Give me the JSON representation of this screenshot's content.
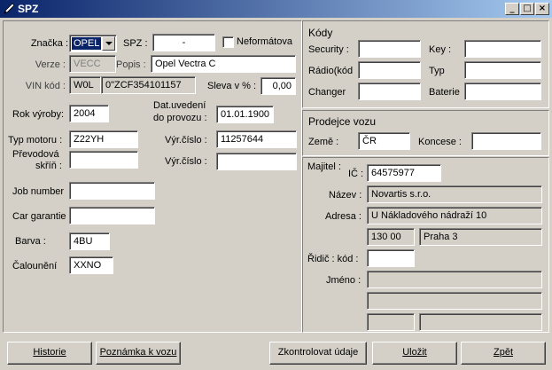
{
  "window": {
    "title": "SPZ",
    "controls": [
      "_",
      "□",
      "×"
    ]
  },
  "vehicle": {
    "znacka_label": "Značka :",
    "znacka_value": "OPEL",
    "spz_label": "SPZ :",
    "spz_value": "-",
    "neformatova_label": "Neformátova",
    "verze_label": "Verze :",
    "verze_value": "VECC",
    "popis_label": "Popis :",
    "popis_value": "Opel Vectra C",
    "vin_label": "VIN kód :",
    "vin_prefix": "W0L",
    "vin_value": "0\"ZCF354101157",
    "sleva_label": "Sleva v % :",
    "sleva_value": "0,00",
    "rok_label": "Rok výroby:",
    "rok_value": "2004",
    "dat_label_1": "Dat.uvedení",
    "dat_label_2": "do provozu :",
    "dat_value": "01.01.1900",
    "typ_motoru_label": "Typ motoru :",
    "typ_motoru_value": "Z22YH",
    "vyr_cislo_label_1": "Výr.číslo :",
    "vyr_cislo_value_1": "11257644",
    "prevodova_label_1": "Převodová",
    "prevodova_label_2": "skříň :",
    "prevodova_value": "",
    "vyr_cislo_label_2": "Výr.číslo :",
    "vyr_cislo_value_2": "",
    "job_label": "Job number",
    "job_value": "",
    "car_label": "Car garantie",
    "car_value": "",
    "barva_label": "Barva :",
    "barva_value": "4BU",
    "calouneni_label": "Čalounění",
    "calouneni_value": "XXNO"
  },
  "kody": {
    "title": "Kódy",
    "security_label": "Security :",
    "security_value": "",
    "key_label": "Key :",
    "key_value": "",
    "radio_label": "Rádio(kód",
    "radio_value": "",
    "typ_label": "Typ",
    "typ_value": "",
    "changer_label": "Changer",
    "changer_value": "",
    "baterie_label": "Baterie",
    "baterie_value": ""
  },
  "prodejce": {
    "title": "Prodejce vozu",
    "zeme_label": "Země :",
    "zeme_value": "ČR",
    "koncese_label": "Koncese :",
    "koncese_value": ""
  },
  "majitel": {
    "title": "Majitel :",
    "ic_label": "IČ :",
    "ic_value": "64575977",
    "nazev_label": "Název :",
    "nazev_value": "Novartis s.r.o.",
    "adresa_label": "Adresa :",
    "adresa_value": "U Nákladového nádraží 10",
    "psc_value": "130 00",
    "mesto_value": "Praha 3",
    "ridic_label": "Řidič : kód :",
    "ridic_value": "",
    "jmeno_label": "Jméno :",
    "jmeno_value": ""
  },
  "buttons": {
    "historie": "Historie",
    "poznamka": "Poznámka k vozu",
    "zkontrolovat": "Zkontrolovat údaje",
    "ulozit": "Uložit",
    "zpet": "Zpět"
  }
}
